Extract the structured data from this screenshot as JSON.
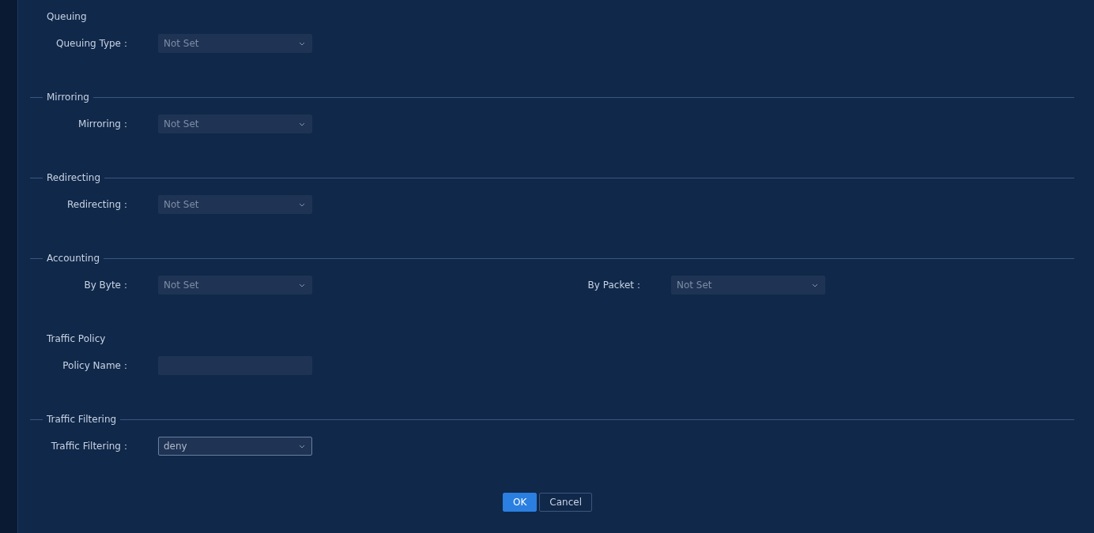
{
  "sections": [
    {
      "title": "Queuing",
      "divider": false,
      "fields": [
        {
          "kind": "select",
          "label": "Queuing Type：",
          "value": "Not Set",
          "disabled": true
        }
      ]
    },
    {
      "title": "Mirroring",
      "divider": true,
      "fields": [
        {
          "kind": "select",
          "label": "Mirroring：",
          "value": "Not Set",
          "disabled": true
        }
      ]
    },
    {
      "title": "Redirecting",
      "divider": true,
      "fields": [
        {
          "kind": "select",
          "label": "Redirecting：",
          "value": "Not Set",
          "disabled": true
        }
      ]
    },
    {
      "title": "Accounting",
      "divider": true,
      "fields": [
        {
          "kind": "select",
          "label": "By Byte：",
          "value": "Not Set",
          "disabled": true
        },
        {
          "kind": "select",
          "label": "By Packet：",
          "value": "Not Set",
          "disabled": true
        }
      ]
    },
    {
      "title": "Traffic Policy",
      "divider": false,
      "fields": [
        {
          "kind": "text",
          "label": "Policy Name：",
          "disabled": true
        }
      ]
    },
    {
      "title": "Traffic Filtering",
      "divider": true,
      "fields": [
        {
          "kind": "select",
          "label": "Traffic Filtering：",
          "value": "deny",
          "disabled": false
        }
      ]
    }
  ],
  "buttons": [
    {
      "label": "OK",
      "kind": "primary"
    },
    {
      "label": "Cancel",
      "kind": "secondary"
    }
  ]
}
